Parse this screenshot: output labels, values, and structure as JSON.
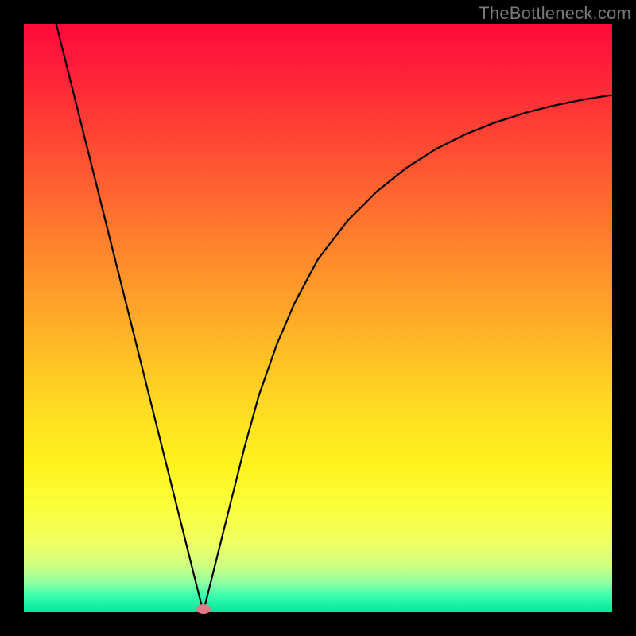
{
  "watermark": "TheBottleneck.com",
  "chart_data": {
    "type": "line",
    "title": "",
    "xlabel": "",
    "ylabel": "",
    "xlim": [
      0,
      1
    ],
    "ylim": [
      0,
      1
    ],
    "grid": false,
    "legend": false,
    "minimum_point": {
      "x": 0.305,
      "y": 0.0
    },
    "marker": {
      "x": 0.305,
      "y": 0.005,
      "color": "#de7d88"
    },
    "series": [
      {
        "name": "bottleneck-curve",
        "color": "#000000",
        "x": [
          0.055,
          0.075,
          0.095,
          0.115,
          0.135,
          0.155,
          0.175,
          0.195,
          0.215,
          0.235,
          0.255,
          0.275,
          0.29,
          0.3,
          0.305,
          0.31,
          0.32,
          0.335,
          0.355,
          0.375,
          0.4,
          0.43,
          0.46,
          0.5,
          0.55,
          0.6,
          0.65,
          0.7,
          0.75,
          0.8,
          0.85,
          0.9,
          0.95,
          1.0
        ],
        "y": [
          1.0,
          0.92,
          0.84,
          0.76,
          0.68,
          0.6,
          0.52,
          0.44,
          0.36,
          0.28,
          0.2,
          0.12,
          0.06,
          0.02,
          0.0,
          0.02,
          0.06,
          0.12,
          0.2,
          0.28,
          0.37,
          0.455,
          0.525,
          0.6,
          0.665,
          0.715,
          0.755,
          0.787,
          0.812,
          0.832,
          0.848,
          0.861,
          0.871,
          0.879
        ]
      }
    ],
    "background_gradient": {
      "direction": "vertical",
      "stops": [
        {
          "pos": 0.0,
          "color": "#ff0a3a"
        },
        {
          "pos": 0.5,
          "color": "#ffb020"
        },
        {
          "pos": 0.8,
          "color": "#fff31e"
        },
        {
          "pos": 1.0,
          "color": "#00e59b"
        }
      ]
    }
  }
}
